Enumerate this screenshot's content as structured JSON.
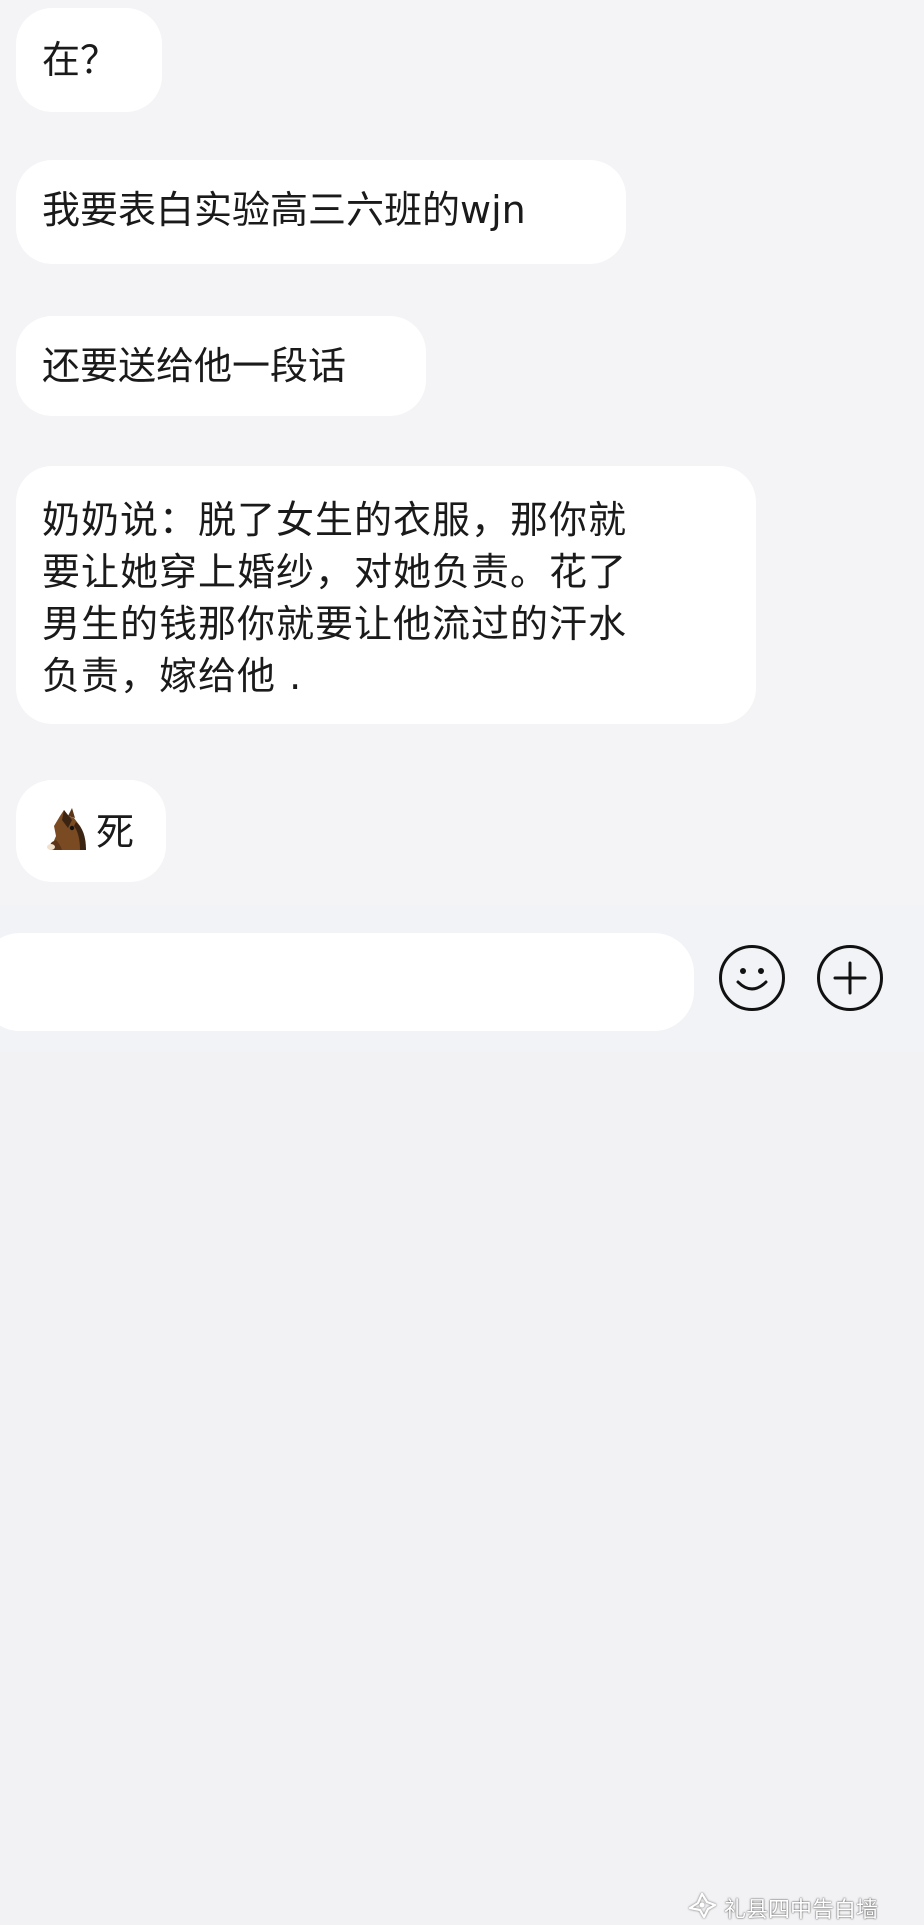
{
  "messages": [
    {
      "text": "在？"
    },
    {
      "text": "我要表白实验高三六班的wjn"
    },
    {
      "text": "还要送给他一段话"
    },
    {
      "lines": [
        "奶奶说：脱了女生的衣服，那你就",
        "要让她穿上婚纱，对她负责。花了",
        "男生的钱那你就要让他流过的汗水",
        "负责，嫁给他 ."
      ]
    },
    {
      "emoji": "horse-emoji",
      "text": "死"
    }
  ],
  "input_bar": {
    "input_value": "",
    "emoji_button_icon": "smiley-icon",
    "plus_button_icon": "plus-icon"
  },
  "watermark": {
    "text": "礼县四中告白墙",
    "icon": "wechat-official-account-icon"
  },
  "colors": {
    "chat_background": "#f4f4f6",
    "bubble": "#ffffff",
    "input_bar": "#f2f3f7",
    "text": "#1a1a1a"
  }
}
